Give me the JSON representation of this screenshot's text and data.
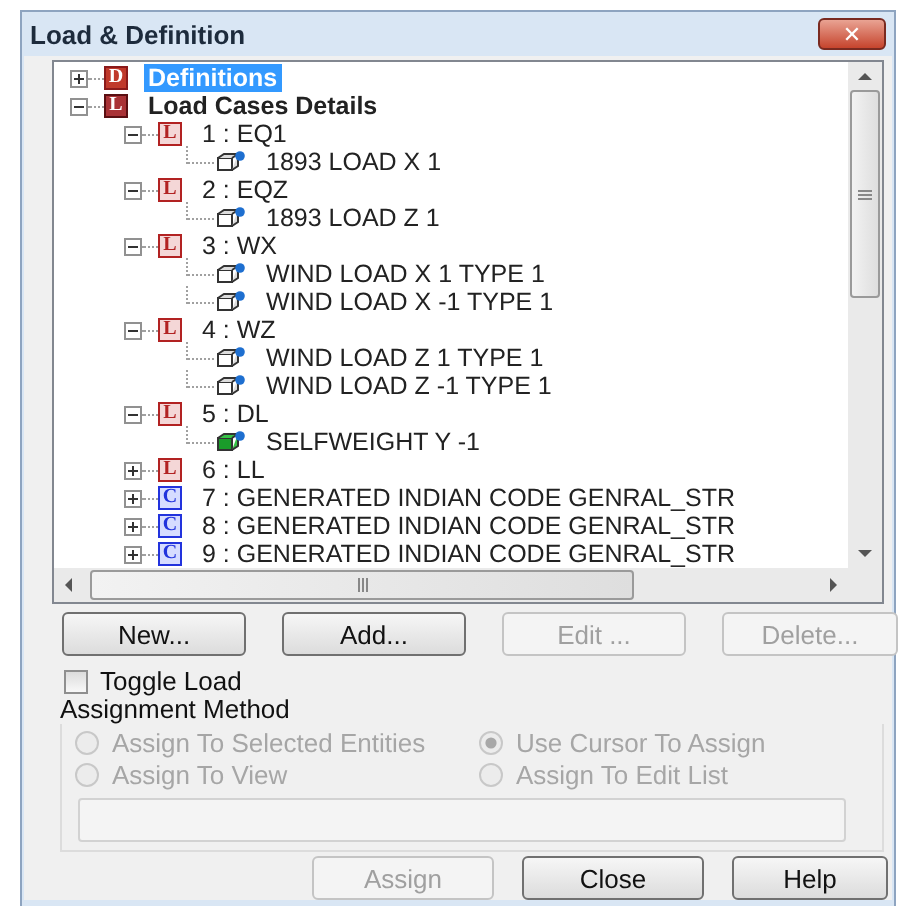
{
  "window": {
    "title": "Load & Definition",
    "close": "✕"
  },
  "tree": [
    {
      "label": "Definitions",
      "badge": "D",
      "kind": "definitions",
      "expanded": false,
      "selected": true
    },
    {
      "label": "Load Cases Details",
      "badge": "L",
      "kind": "group",
      "expanded": true,
      "selected": false,
      "children": [
        {
          "label": "1 : EQ1",
          "badge": "L",
          "kind": "case",
          "expanded": true,
          "selected": false,
          "children": [
            {
              "label": "1893 LOAD X 1",
              "kind": "load",
              "selected": false
            }
          ]
        },
        {
          "label": "2 : EQZ",
          "badge": "L",
          "kind": "case",
          "expanded": true,
          "selected": false,
          "children": [
            {
              "label": "1893 LOAD Z 1",
              "kind": "load",
              "selected": false
            }
          ]
        },
        {
          "label": "3 : WX",
          "badge": "L",
          "kind": "case",
          "expanded": true,
          "selected": false,
          "children": [
            {
              "label": "WIND LOAD X 1 TYPE 1",
              "kind": "load",
              "selected": false
            },
            {
              "label": "WIND LOAD X -1 TYPE 1",
              "kind": "load",
              "selected": false
            }
          ]
        },
        {
          "label": "4 : WZ",
          "badge": "L",
          "kind": "case",
          "expanded": true,
          "selected": false,
          "children": [
            {
              "label": "WIND LOAD Z 1 TYPE 1",
              "kind": "load",
              "selected": false
            },
            {
              "label": "WIND LOAD Z -1 TYPE 1",
              "kind": "load",
              "selected": false
            }
          ]
        },
        {
          "label": "5 : DL",
          "badge": "L",
          "kind": "case",
          "expanded": true,
          "selected": false,
          "children": [
            {
              "label": "SELFWEIGHT Y -1",
              "kind": "selfweight",
              "selected": false
            }
          ]
        },
        {
          "label": "6 : LL",
          "badge": "L",
          "kind": "case",
          "expanded": false,
          "selected": false
        },
        {
          "label": "7 : GENERATED INDIAN CODE GENRAL_STR",
          "badge": "C",
          "kind": "combination",
          "expanded": false,
          "selected": false
        },
        {
          "label": "8 : GENERATED INDIAN CODE GENRAL_STR",
          "badge": "C",
          "kind": "combination",
          "expanded": false,
          "selected": false
        },
        {
          "label": "9 : GENERATED INDIAN CODE GENRAL_STR",
          "badge": "C",
          "kind": "combination",
          "expanded": false,
          "selected": false
        }
      ]
    }
  ],
  "buttons": [
    {
      "label": "New...",
      "disabled": false
    },
    {
      "label": "Add...",
      "disabled": false
    },
    {
      "label": "Edit ...",
      "disabled": true
    },
    {
      "label": "Delete...",
      "disabled": true
    }
  ],
  "toggle_load": {
    "label": "Toggle Load",
    "checked": false
  },
  "assignment_method": {
    "title": "Assignment Method",
    "disabled": true,
    "options": [
      {
        "label": "Assign To Selected Entities",
        "selected": false
      },
      {
        "label": "Use Cursor To Assign",
        "selected": true
      },
      {
        "label": "Assign To View",
        "selected": false
      },
      {
        "label": "Assign To Edit List",
        "selected": false
      }
    ]
  },
  "footer_buttons": [
    {
      "label": "Assign",
      "disabled": true
    },
    {
      "label": "Close",
      "disabled": false
    },
    {
      "label": "Help",
      "disabled": false
    }
  ]
}
